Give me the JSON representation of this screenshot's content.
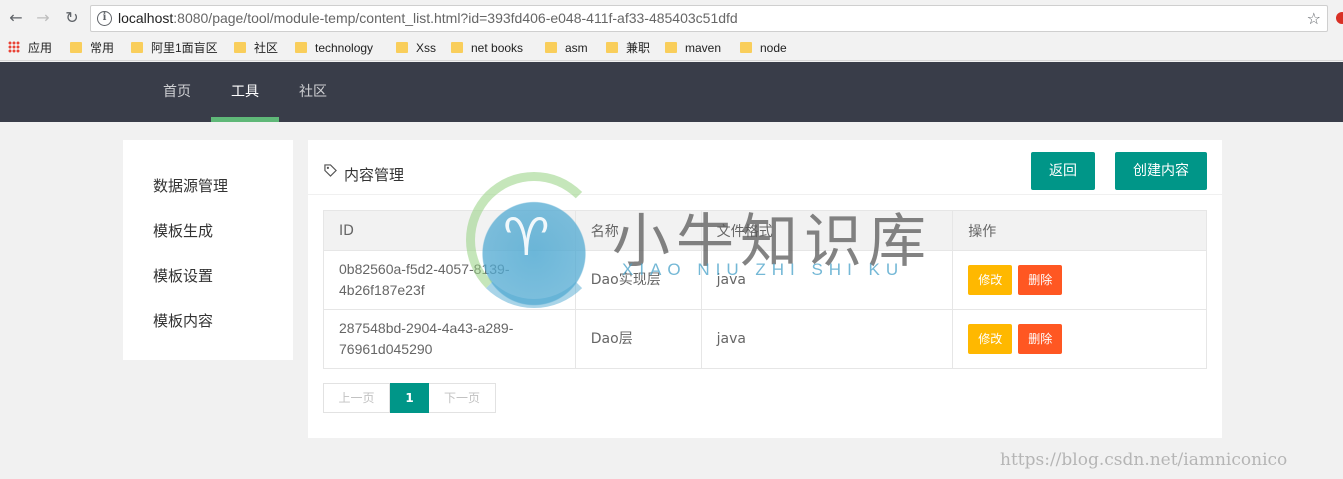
{
  "browser": {
    "url_host": "localhost",
    "url_path": ":8080/page/tool/module-temp/content_list.html?id=393fd406-e048-411f-af33-485403c51dfd",
    "bookmarks": [
      "应用",
      "常用",
      "阿里1面盲区",
      "社区",
      "technology",
      "Xss",
      "net books",
      "asm",
      "兼职",
      "maven",
      "node"
    ]
  },
  "topnav": {
    "items": [
      "首页",
      "工具",
      "社区"
    ],
    "active": "工具"
  },
  "sidebar": {
    "items": [
      "数据源管理",
      "模板生成",
      "模板设置",
      "模板内容"
    ]
  },
  "main": {
    "title": "内容管理",
    "back_label": "返回",
    "create_label": "创建内容",
    "table": {
      "columns": [
        "ID",
        "名称",
        "文件格式",
        "操作"
      ],
      "rows": [
        {
          "id_line1": "0b82560a-f5d2-4057-8139-",
          "id_line2": "4b26f187e23f",
          "name": "Dao实现层",
          "format": "java",
          "edit": "修改",
          "delete": "删除"
        },
        {
          "id_line1": "287548bd-2904-4a43-a289-",
          "id_line2": "76961d045290",
          "name": "Dao层",
          "format": "java",
          "edit": "修改",
          "delete": "删除"
        }
      ]
    },
    "pagination": {
      "prev": "上一页",
      "current": "1",
      "next": "下一页"
    }
  },
  "watermark": {
    "title": "小牛知识库",
    "subtitle": "XIAO NIU ZHI SHI KU",
    "url": "https://blog.csdn.net/iamniconico"
  },
  "colors": {
    "nav_bg": "#393d49",
    "active_bar": "#5fb878",
    "primary": "#009688",
    "edit": "#ffb800",
    "delete": "#ff5722"
  }
}
